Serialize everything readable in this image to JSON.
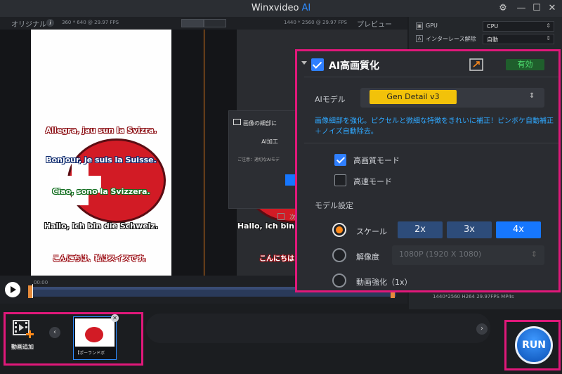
{
  "app": {
    "title_main": "Winxvideo",
    "title_ai": "AI"
  },
  "window_controls": {
    "settings": "⚙",
    "minimize": "—",
    "maximize": "☐",
    "close": "✕"
  },
  "preview": {
    "original_label": "オリジナル",
    "original_info": "360 * 640 @ 29.97 FPS",
    "output_info": "1440 * 2560 @ 29.97 FPS",
    "preview_label": "プレビュー",
    "greetings": [
      "Allegra, jau sun la Svizra.",
      "Bonjour, je suis la Suisse.",
      "Ciao, sono la Svizzera.",
      "Hallo, ich bin die Schweiz.",
      "こんにちは、私はスイスです。"
    ],
    "right_greetings": [
      "Hallo, ich bin",
      "こんにちは"
    ]
  },
  "bg_dialog": {
    "title": "画像の細部に",
    "message": "AI加工",
    "note": "ご注意：適切なAIモデ",
    "checkbox_label": "次"
  },
  "sidebar": {
    "rows": [
      {
        "icon": "▣",
        "label": "GPU",
        "value": "CPU"
      },
      {
        "icon": "A",
        "label": "インターレース解除",
        "value": "自動"
      }
    ],
    "footer": "1440*2560  H264  29.97FPS  MP4s"
  },
  "timeline": {
    "time": "00:00"
  },
  "queue": {
    "add_label": "動画追加",
    "thumb_label": "【ポーランドボ",
    "prev": "‹",
    "next": "›",
    "close": "✕"
  },
  "run": {
    "label": "RUN"
  },
  "ai_panel": {
    "title": "AI高画質化",
    "enabled_label": "有効",
    "model_label": "AIモデル",
    "model_value": "Gen Detail v3",
    "description": "画像細部を強化。ピクセルと微細な特徴をきれいに補正！ピンボケ自動補正＋ノイズ自動除去。",
    "high_quality_mode": "高画質モード",
    "high_speed_mode": "高速モード",
    "model_settings": "モデル設定",
    "scale_label": "スケール",
    "scale_options": [
      "2x",
      "3x",
      "4x"
    ],
    "resolution_label": "解像度",
    "resolution_value": "1080P (1920 X 1080)",
    "enhance_label": "動画強化（1x）"
  },
  "colors": {
    "accent": "#1677ff",
    "highlight": "#e0187a",
    "model_chip": "#f2c20a",
    "enabled": "#4fe070"
  }
}
